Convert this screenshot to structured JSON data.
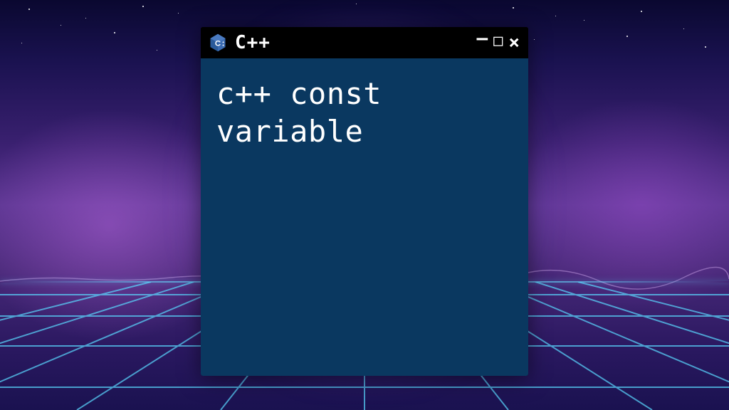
{
  "window": {
    "title": "C++",
    "body_text": "c++ const\nvariable"
  },
  "icons": {
    "app": "cpp-logo-icon",
    "minimize": "minimize-icon",
    "maximize": "maximize-icon",
    "close": "close-icon"
  },
  "colors": {
    "window_body": "#0a3860",
    "titlebar": "#000000",
    "text": "#ffffff",
    "glow": "#9678ff",
    "grid_line": "#5ad8ff"
  }
}
